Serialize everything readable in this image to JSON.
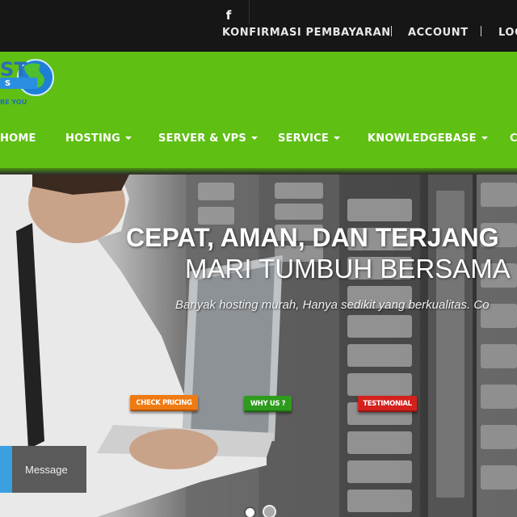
{
  "topbar": {
    "social_icon": "facebook-icon",
    "links": [
      "KONFIRMASI PEMBAYARAN",
      "ACCOUNT",
      "LOG"
    ]
  },
  "brand": {
    "logo_text_1": "ST",
    "logo_text_2": "S",
    "logo_text_3": "RE YOU",
    "logo_icon": "globe-icon"
  },
  "nav": {
    "items": [
      {
        "label": "HOME",
        "has_caret": false
      },
      {
        "label": "HOSTING",
        "has_caret": true
      },
      {
        "label": "SERVER & VPS",
        "has_caret": true
      },
      {
        "label": "SERVICE",
        "has_caret": true
      },
      {
        "label": "KNOWLEDGEBASE",
        "has_caret": true
      },
      {
        "label": "C",
        "has_caret": false
      }
    ]
  },
  "hero": {
    "headline": "CEPAT, AMAN, DAN TERJANG",
    "subheadline": "MARI TUMBUH BERSAMA",
    "tagline": "Banyak hosting murah, Hanya sedikit yang berkualitas. Co",
    "buttons": [
      {
        "label": "CHECK PRICING",
        "color": "#f07a12"
      },
      {
        "label": "WHY US ?",
        "color": "#2e9b1d"
      },
      {
        "label": "TESTIMONIAL",
        "color": "#d4211c"
      }
    ],
    "slide_count": 2,
    "active_slide": 1
  },
  "chat": {
    "label": "Message",
    "accent": "#3ba0e0"
  },
  "colors": {
    "header_green": "#5fbf13",
    "topbar": "#161616"
  }
}
